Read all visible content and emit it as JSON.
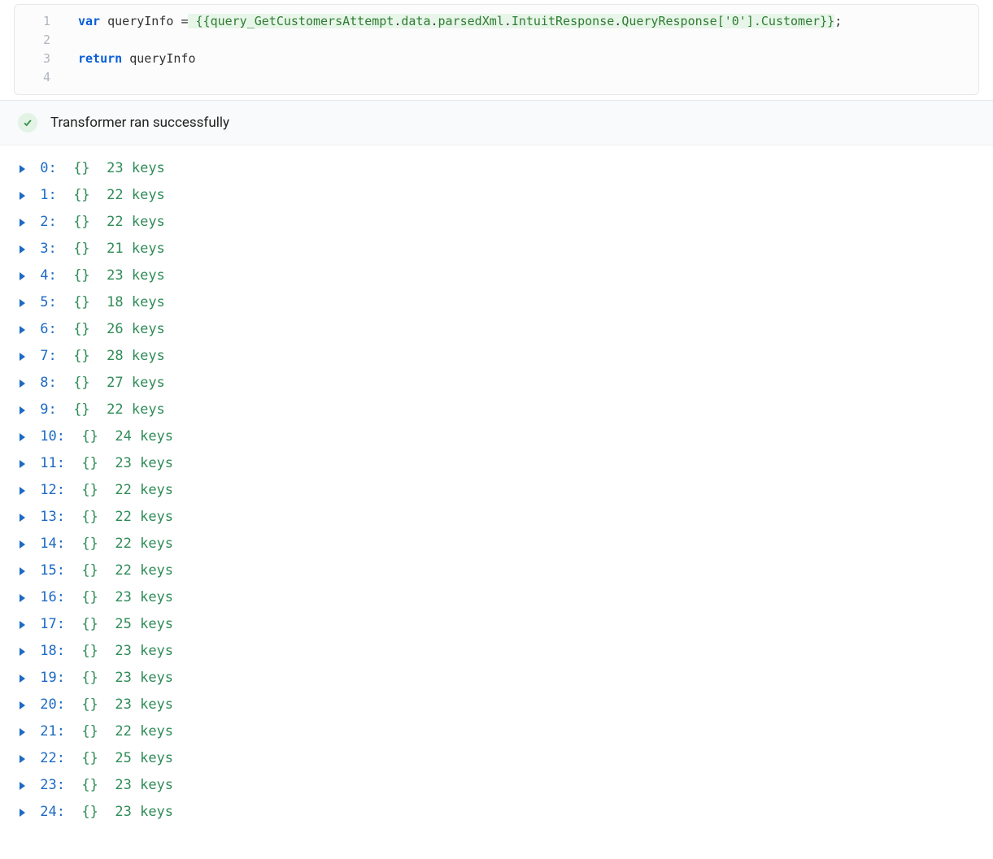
{
  "editor": {
    "lineNumbers": [
      "1",
      "2",
      "3",
      "4"
    ],
    "line1": {
      "kw": "var",
      "var": " queryInfo ",
      "eq": "=",
      "open": " {{",
      "parts": [
        "query_GetCustomersAttempt",
        "data",
        "parsedXml",
        "IntuitResponse",
        "QueryResponse"
      ],
      "index": "['0']",
      "tail": ".Customer",
      "close": "}}",
      "semi": ";"
    },
    "line3": {
      "kw": "return",
      "var": " queryInfo"
    }
  },
  "status": {
    "text": "Transformer ran successfully"
  },
  "results": [
    {
      "idx": "0",
      "keys": "23 keys"
    },
    {
      "idx": "1",
      "keys": "22 keys"
    },
    {
      "idx": "2",
      "keys": "22 keys"
    },
    {
      "idx": "3",
      "keys": "21 keys"
    },
    {
      "idx": "4",
      "keys": "23 keys"
    },
    {
      "idx": "5",
      "keys": "18 keys"
    },
    {
      "idx": "6",
      "keys": "26 keys"
    },
    {
      "idx": "7",
      "keys": "28 keys"
    },
    {
      "idx": "8",
      "keys": "27 keys"
    },
    {
      "idx": "9",
      "keys": "22 keys"
    },
    {
      "idx": "10",
      "keys": "24 keys"
    },
    {
      "idx": "11",
      "keys": "23 keys"
    },
    {
      "idx": "12",
      "keys": "22 keys"
    },
    {
      "idx": "13",
      "keys": "22 keys"
    },
    {
      "idx": "14",
      "keys": "22 keys"
    },
    {
      "idx": "15",
      "keys": "22 keys"
    },
    {
      "idx": "16",
      "keys": "23 keys"
    },
    {
      "idx": "17",
      "keys": "25 keys"
    },
    {
      "idx": "18",
      "keys": "23 keys"
    },
    {
      "idx": "19",
      "keys": "23 keys"
    },
    {
      "idx": "20",
      "keys": "23 keys"
    },
    {
      "idx": "21",
      "keys": "22 keys"
    },
    {
      "idx": "22",
      "keys": "25 keys"
    },
    {
      "idx": "23",
      "keys": "23 keys"
    },
    {
      "idx": "24",
      "keys": "23 keys"
    }
  ]
}
